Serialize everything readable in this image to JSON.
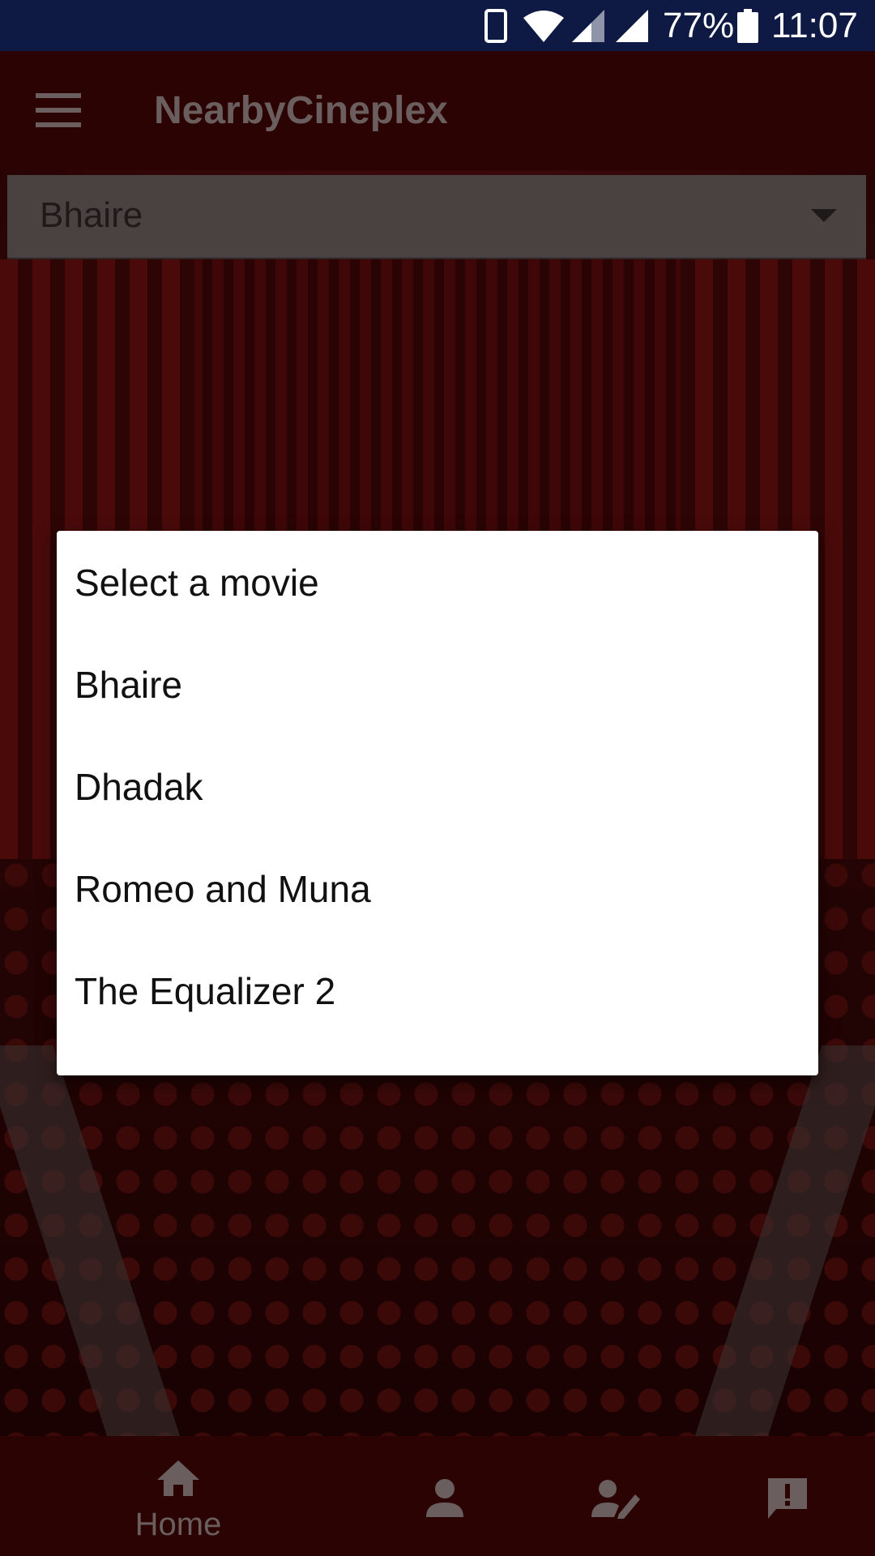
{
  "status_bar": {
    "battery_percent": "77%",
    "time": "11:07",
    "icons": [
      "phone-icon",
      "wifi-icon",
      "cell-signal-icon",
      "cell-signal-icon",
      "battery-icon"
    ]
  },
  "app_bar": {
    "title": "NearbyCineplex",
    "menu_icon": "hamburger-menu-icon"
  },
  "spinner": {
    "selected": "Bhaire",
    "icon": "dropdown-arrow-icon"
  },
  "dialog": {
    "options": [
      "Select a movie",
      "Bhaire",
      "Dhadak",
      "Romeo and Muna",
      "The Equalizer 2"
    ]
  },
  "bottom_nav": {
    "home_label": "Home",
    "icons": [
      "home-icon",
      "person-icon",
      "rate-review-icon",
      "feedback-icon"
    ]
  },
  "colors": {
    "status_bar": "#0f1a44",
    "app_bar_dimmed": "#2c0303",
    "dialog_background": "#ffffff",
    "dialog_text": "#111111"
  }
}
